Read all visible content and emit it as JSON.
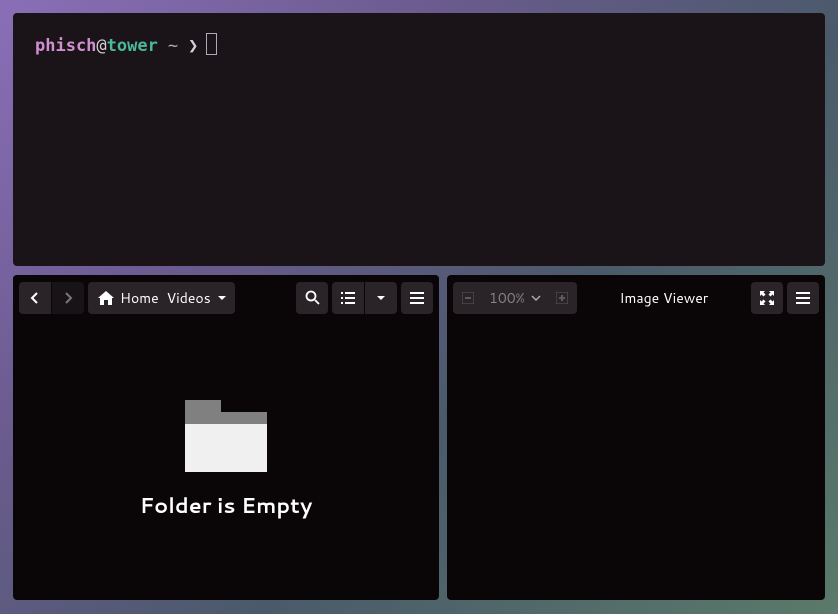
{
  "terminal": {
    "user": "phisch",
    "at": "@",
    "host": "tower",
    "path": "~",
    "arrow": "❯"
  },
  "file_manager": {
    "breadcrumbs": {
      "home_label": "Home",
      "current": "Videos"
    },
    "empty_state": "Folder is Empty"
  },
  "image_viewer": {
    "zoom_level": "100%",
    "title": "Image Viewer"
  }
}
